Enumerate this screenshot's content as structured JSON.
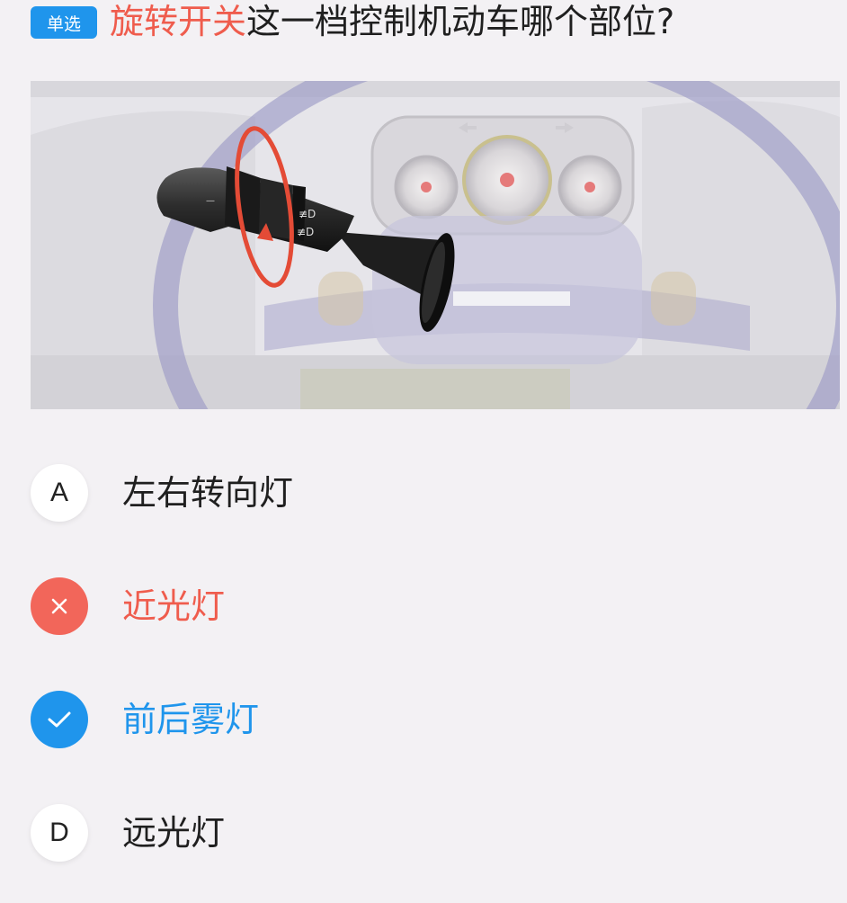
{
  "question": {
    "type_label": "单选",
    "highlight_text": "旋转开关",
    "rest_text": "这一档控制机动车哪个部位?"
  },
  "illustration": {
    "stalk_mark": "—",
    "fog_symbol_front": "≢D",
    "fog_symbol_rear": "≢D"
  },
  "options": [
    {
      "letter": "A",
      "text": "左右转向灯",
      "state": "normal"
    },
    {
      "letter": "",
      "text": "近光灯",
      "state": "wrong",
      "icon": "cross-icon"
    },
    {
      "letter": "",
      "text": "前后雾灯",
      "state": "correct",
      "icon": "check-icon"
    },
    {
      "letter": "D",
      "text": "远光灯",
      "state": "normal"
    }
  ],
  "colors": {
    "accent_blue": "#1f95ec",
    "wrong_red": "#ef5c4d",
    "background": "#f3f1f4"
  }
}
